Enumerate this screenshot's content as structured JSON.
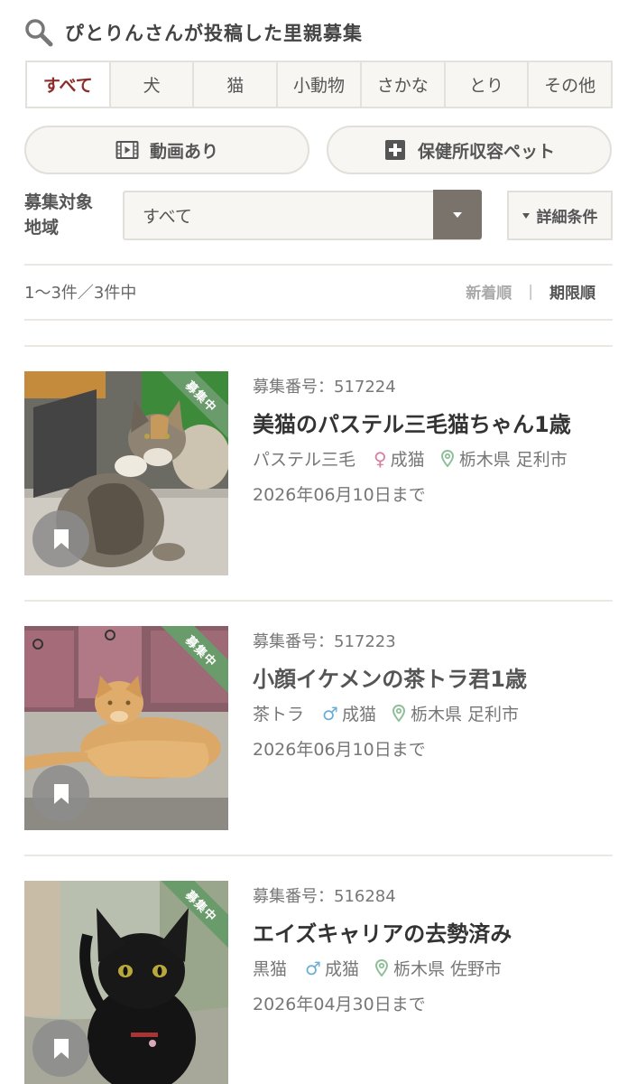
{
  "header": {
    "title": "ぴとりんさんが投稿した里親募集"
  },
  "tabs": [
    "すべて",
    "犬",
    "猫",
    "小動物",
    "さかな",
    "とり",
    "その他"
  ],
  "filters": {
    "video_label": "動画あり",
    "shelter_label": "保健所収容ペット",
    "area_label_1": "募集対象",
    "area_label_2": "地域",
    "area_value": "すべて",
    "detail_label": "詳細条件"
  },
  "results": {
    "count": "1〜3件／3件中",
    "sort_new": "新着順",
    "sort_sep": "|",
    "sort_deadline": "期限順"
  },
  "listings": [
    {
      "status": "募集中",
      "number": "募集番号：517224",
      "name": "美猫のパステル三毛猫ちゃん1歳",
      "breed": "パステル三毛",
      "sex_symbol": "♀",
      "sex_color": "#d77fa1",
      "age": "成猫",
      "location": "栃木県 足利市",
      "deadline": "2026年06月10日まで"
    },
    {
      "status": "募集中",
      "number": "募集番号：517223",
      "name": "小顔イケメンの茶トラ君1歳",
      "breed": "茶トラ",
      "sex_symbol": "♂",
      "sex_color": "#6aaed6",
      "age": "成猫",
      "location": "栃木県 足利市",
      "deadline": "2026年06月10日まで"
    },
    {
      "status": "募集中",
      "number": "募集番号：516284",
      "name": "エイズキャリアの去勢済み",
      "breed": "黒猫",
      "sex_symbol": "♂",
      "sex_color": "#6aaed6",
      "age": "成猫",
      "location": "栃木県 佐野市",
      "deadline": "2026年04月30日まで"
    }
  ],
  "colors": {
    "accent": "#8b2e2a",
    "ribbon": "#6a9b6b",
    "pin": "#8fbf99"
  }
}
